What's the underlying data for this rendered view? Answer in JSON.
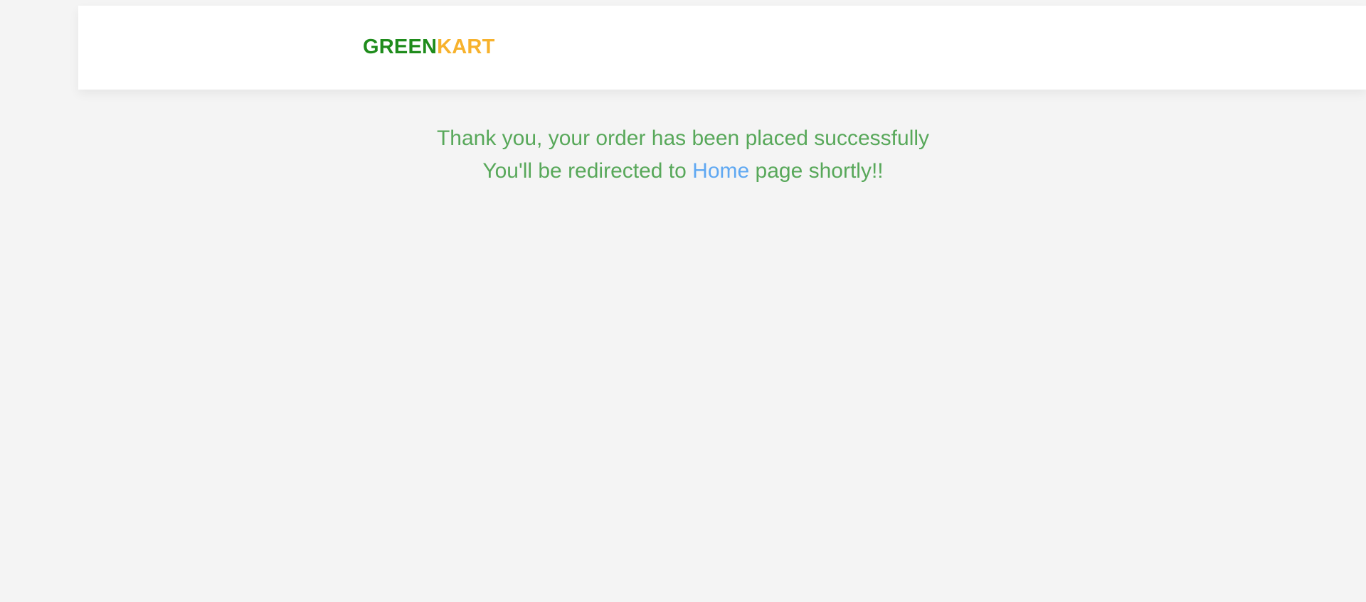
{
  "header": {
    "brand": {
      "part1": "GREEN",
      "part2": "KART",
      "colors": {
        "part1": "#1f8c1c",
        "part2": "#f7b22d"
      }
    }
  },
  "confirmation": {
    "line1": "Thank you, your order has been placed successfully",
    "line2_prefix": "You'll be redirected to ",
    "home_link": "Home",
    "line2_suffix": " page shortly!!",
    "colors": {
      "text": "#58a85a",
      "link": "#5fa8f2"
    }
  }
}
